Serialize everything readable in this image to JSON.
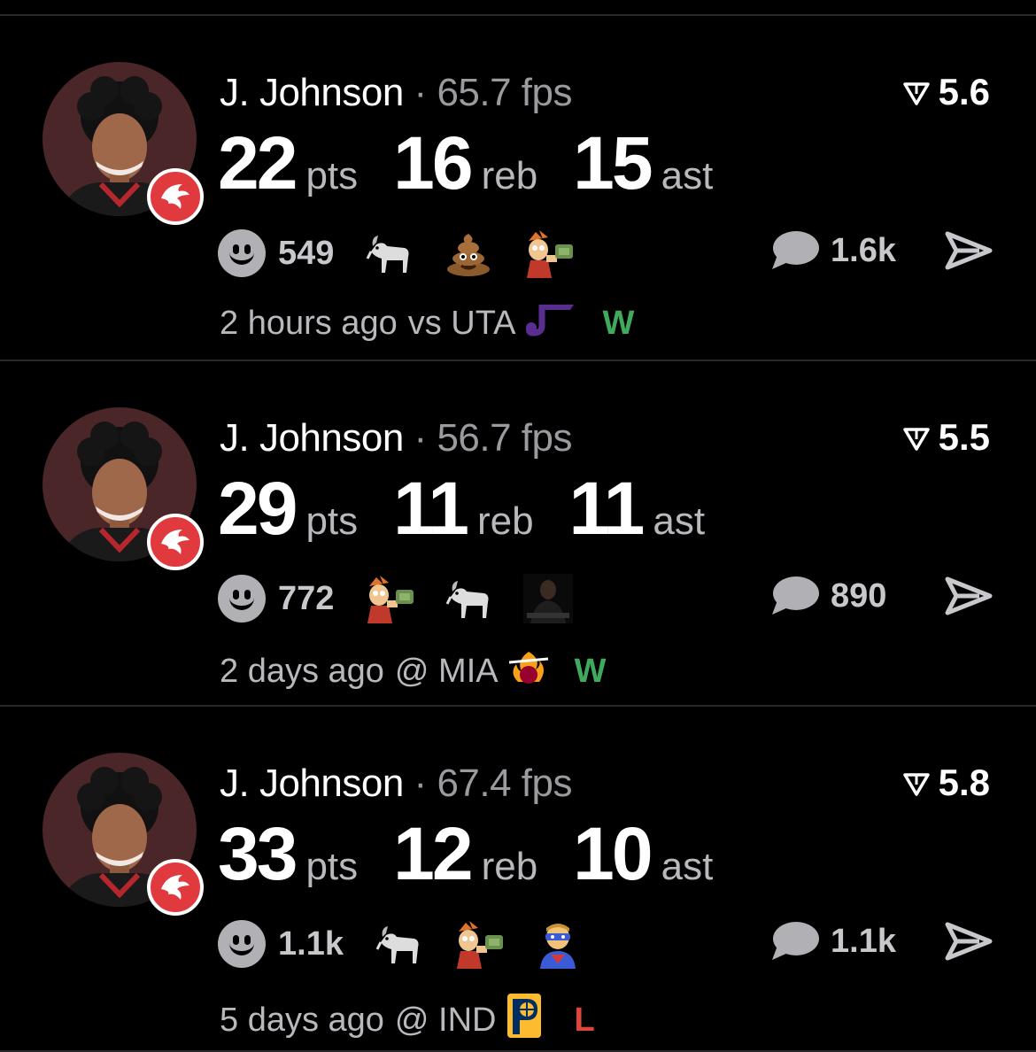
{
  "colors": {
    "background": "#000000",
    "win": "#3faa5b",
    "loss": "#e0443a",
    "muted": "#9a9a9f",
    "team_badge": "#e03a3e"
  },
  "cards": [
    {
      "player": "J. Johnson",
      "separator": "·",
      "fps": "65.7 fps",
      "rating": "5.6",
      "stats": [
        {
          "value": "22",
          "unit": "pts"
        },
        {
          "value": "16",
          "unit": "reb"
        },
        {
          "value": "15",
          "unit": "ast"
        }
      ],
      "reaction_count": "549",
      "reaction_icons": [
        "goat-emoji",
        "poop-emoji",
        "fry-money-emoji"
      ],
      "comment_count": "1.6k",
      "time": "2 hours ago",
      "opponent": "vs UTA",
      "opponent_logo": "jazz-logo",
      "result": "W"
    },
    {
      "player": "J. Johnson",
      "separator": "·",
      "fps": "56.7 fps",
      "rating": "5.5",
      "stats": [
        {
          "value": "29",
          "unit": "pts"
        },
        {
          "value": "11",
          "unit": "reb"
        },
        {
          "value": "11",
          "unit": "ast"
        }
      ],
      "reaction_count": "772",
      "reaction_icons": [
        "fry-money-emoji",
        "goat-emoji",
        "dark-figure-emoji"
      ],
      "comment_count": "890",
      "time": "2 days ago",
      "opponent": "@ MIA",
      "opponent_logo": "heat-logo",
      "result": "W"
    },
    {
      "player": "J. Johnson",
      "separator": "·",
      "fps": "67.4 fps",
      "rating": "5.8",
      "stats": [
        {
          "value": "33",
          "unit": "pts"
        },
        {
          "value": "12",
          "unit": "reb"
        },
        {
          "value": "10",
          "unit": "ast"
        }
      ],
      "reaction_count": "1.1k",
      "reaction_icons": [
        "goat-emoji",
        "fry-money-emoji",
        "masked-hero-emoji"
      ],
      "comment_count": "1.1k",
      "time": "5 days ago",
      "opponent": "@ IND",
      "opponent_logo": "pacers-logo",
      "result": "L"
    }
  ]
}
